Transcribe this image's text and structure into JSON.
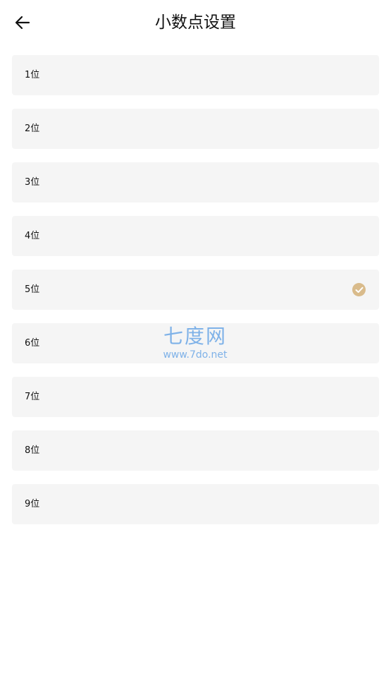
{
  "header": {
    "title": "小数点设置",
    "back_icon": "arrow-left-icon"
  },
  "options": [
    {
      "label": "1位",
      "selected": false
    },
    {
      "label": "2位",
      "selected": false
    },
    {
      "label": "3位",
      "selected": false
    },
    {
      "label": "4位",
      "selected": false
    },
    {
      "label": "5位",
      "selected": true
    },
    {
      "label": "6位",
      "selected": false
    },
    {
      "label": "7位",
      "selected": false
    },
    {
      "label": "8位",
      "selected": false
    },
    {
      "label": "9位",
      "selected": false
    }
  ],
  "selected_icon": "check-circle-icon",
  "watermark": {
    "title": "七度网",
    "url": "www.7do.net"
  },
  "colors": {
    "background": "#ffffff",
    "row_background": "#f5f5f5",
    "check_accent": "#d9bb8b",
    "watermark": "#7fb2e8"
  }
}
